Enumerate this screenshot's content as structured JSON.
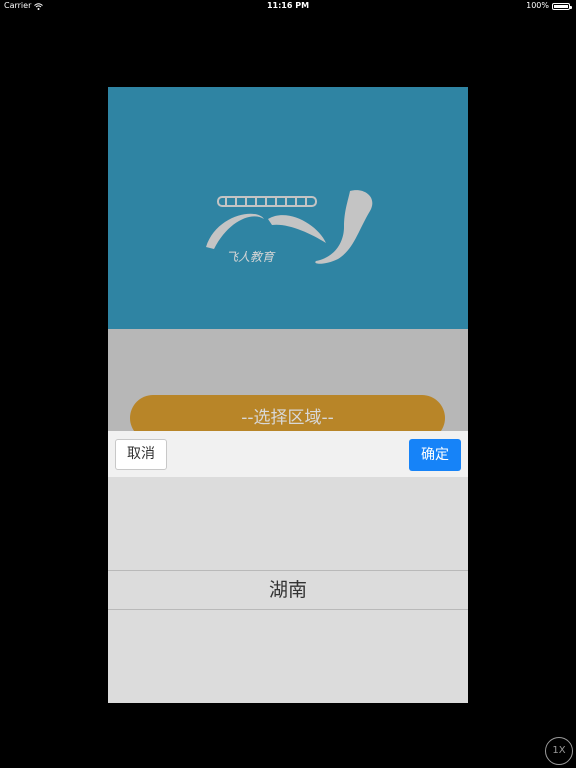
{
  "status_bar": {
    "carrier": "Carrier",
    "time": "11:16 PM",
    "battery": "100%"
  },
  "logo": {
    "text": "飞人教育",
    "colors": {
      "banner": "#2f84a3",
      "mark": "#c4c4c4"
    }
  },
  "region_select": {
    "label": "--选择区域--",
    "color": "#b88528"
  },
  "picker": {
    "cancel_label": "取消",
    "confirm_label": "确定",
    "selected_value": "湖南",
    "colors": {
      "confirm": "#1683f8"
    }
  },
  "zoom_badge": {
    "label": "1X"
  }
}
